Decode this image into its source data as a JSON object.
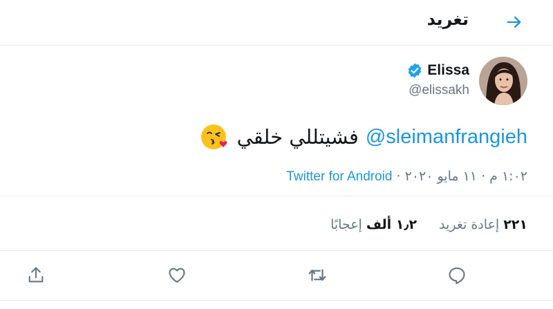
{
  "header": {
    "title": "تغريد",
    "back_icon": "arrow-right-icon"
  },
  "author": {
    "name": "Elissa",
    "handle": "@elissakh",
    "verified": true,
    "verified_icon": "verified-badge-icon",
    "avatar": "avatar"
  },
  "tweet": {
    "mention": "@sleimanfrangieh",
    "text": "فشيتللي خلقي",
    "emoji": "face-blowing-kiss"
  },
  "meta": {
    "time": "١:٠٢ م",
    "separator": "·",
    "date": "١١ مايو ٢٠٢٠",
    "source": "Twitter for Android"
  },
  "stats": {
    "retweets_count": "٢٢١",
    "retweets_label": "إعادة تغريد",
    "likes_count": "١٫٢ ألف",
    "likes_label": "إعجابًا"
  },
  "actions": [
    "reply-icon",
    "retweet-icon",
    "like-icon",
    "share-icon"
  ],
  "colors": {
    "accent": "#1b95e0",
    "secondary_text": "#657786",
    "border": "#e6ecf0"
  }
}
